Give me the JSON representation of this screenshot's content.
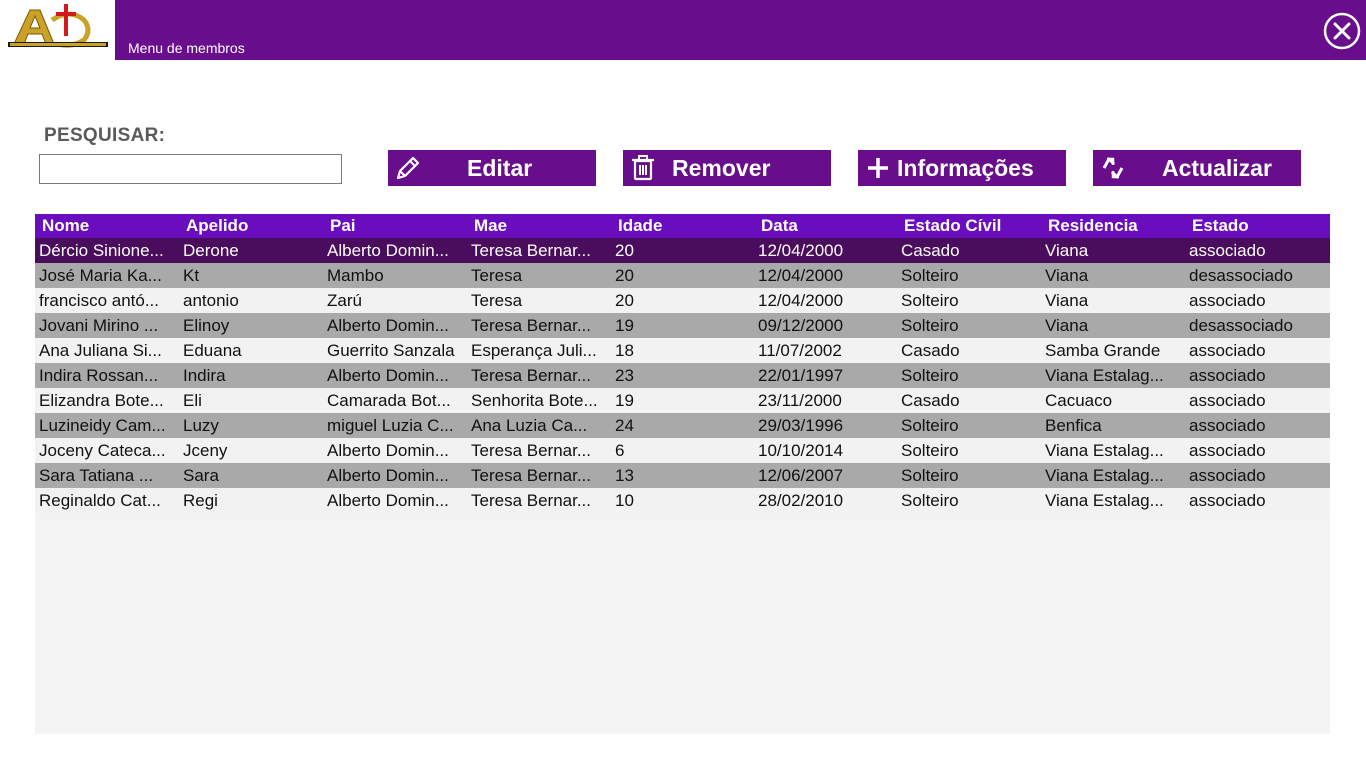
{
  "header": {
    "subtitle": "Menu de membros",
    "logo_text": "Assembleia de Deus Pentecostal"
  },
  "search": {
    "label": "PESQUISAR:",
    "value": "",
    "placeholder": ""
  },
  "toolbar": {
    "edit_label": "Editar",
    "remove_label": "Remover",
    "info_label": "Informações",
    "refresh_label": "Actualizar"
  },
  "colors": {
    "primary": "#680e8c",
    "header": "#6a0dbf",
    "selected_row": "#4a0c5c",
    "alt_row": "#a9a9a9"
  },
  "table": {
    "columns": [
      "Nome",
      "Apelido",
      "Pai",
      "Mae",
      "Idade",
      "Data",
      "Estado Cívil",
      "Residencia",
      "Estado"
    ],
    "rows": [
      [
        "Dércio Sinione...",
        "Derone",
        "Alberto Domin...",
        "Teresa Bernar...",
        "20",
        "12/04/2000",
        "Casado",
        "Viana",
        "associado"
      ],
      [
        "José Maria Ka...",
        "Kt",
        "Mambo",
        "Teresa",
        "20",
        "12/04/2000",
        "Solteiro",
        "Viana",
        "desassociado"
      ],
      [
        "francisco antó...",
        "antonio",
        "Zarú",
        "Teresa",
        "20",
        "12/04/2000",
        "Solteiro",
        "Viana",
        "associado"
      ],
      [
        "Jovani Mirino ...",
        "Elinoy",
        "Alberto Domin...",
        "Teresa Bernar...",
        "19",
        "09/12/2000",
        "Solteiro",
        "Viana",
        "desassociado"
      ],
      [
        "Ana Juliana Si...",
        "Eduana",
        "Guerrito Sanzala",
        "Esperança Juli...",
        "18",
        "11/07/2002",
        "Casado",
        "Samba Grande",
        "associado"
      ],
      [
        "Indira Rossan...",
        "Indira",
        "Alberto Domin...",
        "Teresa Bernar...",
        "23",
        "22/01/1997",
        "Solteiro",
        "Viana Estalag...",
        "associado"
      ],
      [
        "Elizandra Bote...",
        "Eli",
        "Camarada Bot...",
        "Senhorita Bote...",
        "19",
        "23/11/2000",
        "Casado",
        "Cacuaco",
        "associado"
      ],
      [
        "Luzineidy Cam...",
        "Luzy",
        "miguel Luzia C...",
        "Ana Luzia Ca...",
        "24",
        "29/03/1996",
        "Solteiro",
        "Benfica",
        "associado"
      ],
      [
        "Joceny Cateca...",
        "Jceny",
        "Alberto Domin...",
        "Teresa Bernar...",
        "6",
        "10/10/2014",
        "Solteiro",
        "Viana Estalag...",
        "associado"
      ],
      [
        "Sara Tatiana ...",
        "Sara",
        "Alberto Domin...",
        "Teresa Bernar...",
        "13",
        "12/06/2007",
        "Solteiro",
        "Viana Estalag...",
        "associado"
      ],
      [
        "Reginaldo Cat...",
        "Regi",
        "Alberto Domin...",
        "Teresa Bernar...",
        "10",
        "28/02/2010",
        "Solteiro",
        "Viana Estalag...",
        "associado"
      ]
    ],
    "selected_row": 0
  }
}
